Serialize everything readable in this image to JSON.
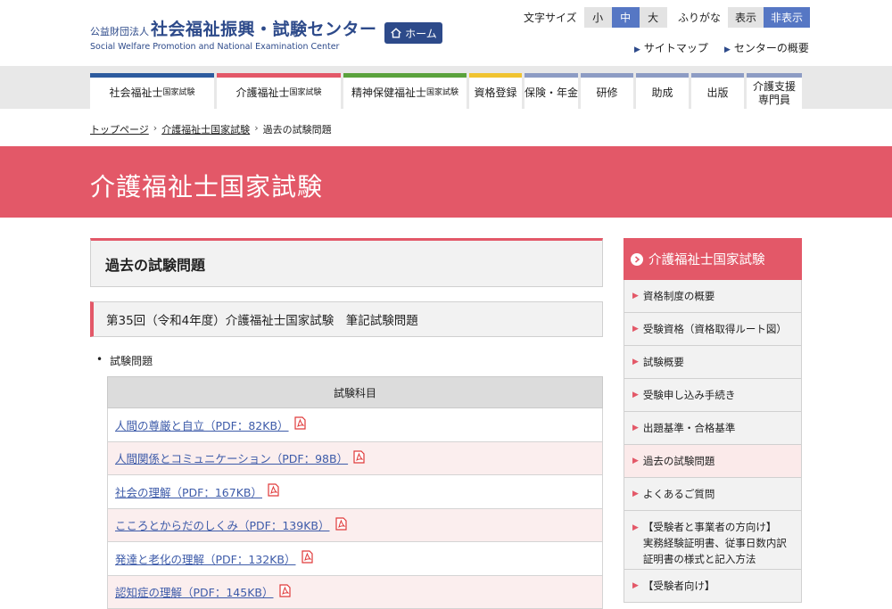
{
  "header": {
    "org_prefix": "公益財団法人",
    "org_name": "社会福祉振興・試験センター",
    "org_name_en": "Social Welfare Promotion and National Examination Center",
    "home_label": "ホーム"
  },
  "font_size_control": {
    "label": "文字サイズ",
    "options": [
      "小",
      "中",
      "大"
    ],
    "selected": "中"
  },
  "furigana_control": {
    "label": "ふりがな",
    "options": [
      "表示",
      "非表示"
    ],
    "selected": "非表示"
  },
  "top_links": [
    "サイトマップ",
    "センターの概要"
  ],
  "nav": {
    "items": [
      {
        "main": "社会福祉士",
        "small": "国家試験",
        "color": "#2d5b9e"
      },
      {
        "main": "介護福祉士",
        "small": "国家試験",
        "color": "#e35868"
      },
      {
        "main": "精神保健福祉士",
        "small": "国家試験",
        "color": "#5aa23c"
      },
      {
        "main": "資格登録",
        "small": "",
        "color": "#f0c330"
      },
      {
        "main": "保険・年金",
        "small": "",
        "color": "#8d9cc4"
      },
      {
        "main": "研修",
        "small": "",
        "color": "#8d9cc4"
      },
      {
        "main": "助成",
        "small": "",
        "color": "#8d9cc4"
      },
      {
        "main": "出版",
        "small": "",
        "color": "#8d9cc4"
      },
      {
        "main": "介護支援専門員",
        "small": "",
        "color": "#8d9cc4"
      }
    ]
  },
  "breadcrumb": [
    "トップページ",
    "介護福祉士国家試験",
    "過去の試験問題"
  ],
  "hero_title": "介護福祉士国家試験",
  "section_title": "過去の試験問題",
  "sub_title": "第35回（令和4年度）介護福祉士国家試験　筆記試験問題",
  "bullet_label": "試験問題",
  "table": {
    "header": "試験科目",
    "rows": [
      "人間の尊厳と自立（PDF：82KB）",
      "人間関係とコミュニケーション（PDF：98B）",
      "社会の理解（PDF：167KB）",
      "こころとからだのしくみ（PDF：139KB）",
      "発達と老化の理解（PDF：132KB）",
      "認知症の理解（PDF：145KB）"
    ]
  },
  "sidebar": {
    "title": "介護福祉士国家試験",
    "items": [
      "資格制度の概要",
      "受験資格（資格取得ルート図）",
      "試験概要",
      "受験申し込み手続き",
      "出題基準・合格基準",
      "過去の試験問題",
      "よくあるご質問"
    ],
    "current": "過去の試験問題",
    "item_multi_line_1": "【受験者と事業者の方向け】",
    "item_multi_line_2": "実務経験証明書、従事日数内訳証明書の様式と記入方法",
    "item_last": "【受験者向け】"
  },
  "colors": {
    "accent": "#e35868",
    "brand": "#2d4a8a",
    "link": "#3d5ba9",
    "active_toggle": "#5677c4"
  }
}
